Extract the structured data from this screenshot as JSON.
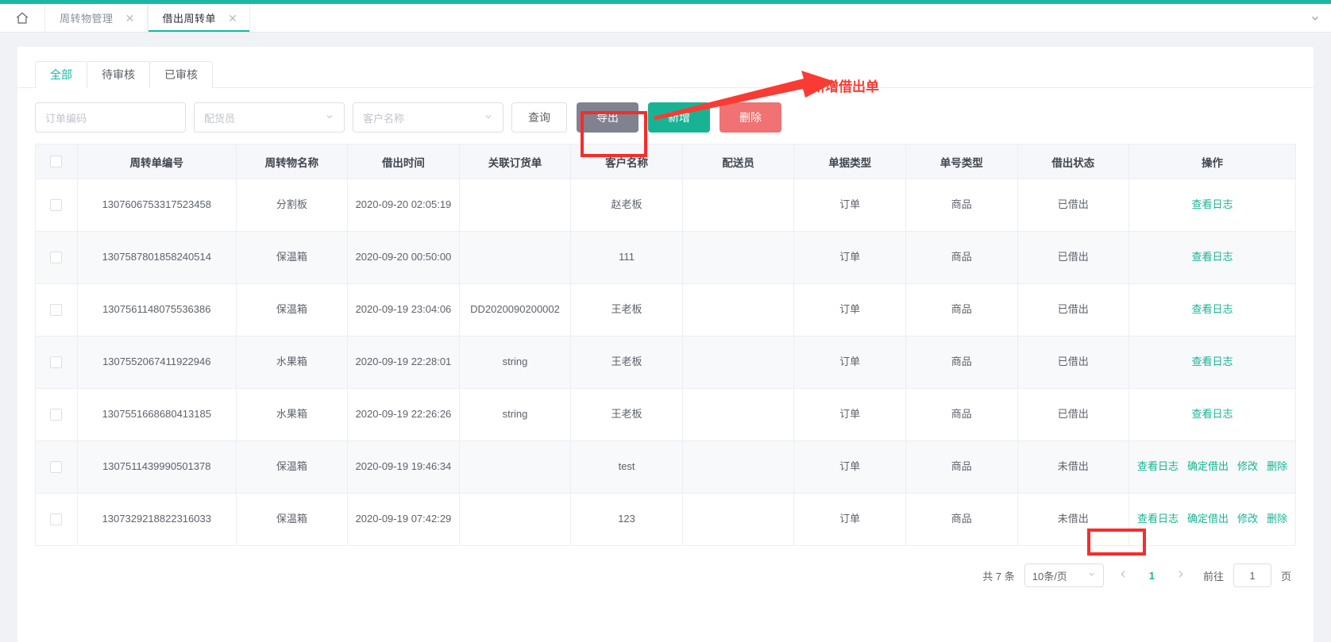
{
  "theme": {
    "accent": "#18b8a5",
    "link": "#18b394",
    "danger": "#f07272",
    "annotation": "#f93b34"
  },
  "tabbar": {
    "home_icon": "home-icon",
    "tabs": [
      {
        "label": "周转物管理",
        "active": false
      },
      {
        "label": "借出周转单",
        "active": true
      }
    ],
    "collapse_icon": "chevron-down-icon"
  },
  "filter_tabs": [
    {
      "label": "全部",
      "active": true
    },
    {
      "label": "待审核",
      "active": false
    },
    {
      "label": "已审核",
      "active": false
    }
  ],
  "search": {
    "order_code_placeholder": "订单编码",
    "order_code_value": "",
    "picker_placeholder": "配货员",
    "picker_value": "",
    "customer_placeholder": "客户名称",
    "customer_value": "",
    "query_label": "查询",
    "export_label": "导出",
    "add_label": "新增",
    "delete_label": "删除"
  },
  "annotation": {
    "text": "新增借出单"
  },
  "table": {
    "columns": [
      "",
      "周转单编号",
      "周转物名称",
      "借出时间",
      "关联订货单",
      "客户名称",
      "配送员",
      "单据类型",
      "单号类型",
      "借出状态",
      "操作"
    ],
    "rows": [
      {
        "code": "1307606753317523458",
        "goods": "分割板",
        "time": "2020-09-20 02:05:19",
        "related_order": "",
        "customer": "赵老板",
        "deliverer": "",
        "doc_type": "订单",
        "no_type": "商品",
        "status": "已借出",
        "ops": [
          "查看日志"
        ]
      },
      {
        "code": "1307587801858240514",
        "goods": "保温箱",
        "time": "2020-09-20 00:50:00",
        "related_order": "",
        "customer": "111",
        "deliverer": "",
        "doc_type": "订单",
        "no_type": "商品",
        "status": "已借出",
        "ops": [
          "查看日志"
        ]
      },
      {
        "code": "1307561148075536386",
        "goods": "保温箱",
        "time": "2020-09-19 23:04:06",
        "related_order": "DD2020090200002",
        "customer": "王老板",
        "deliverer": "",
        "doc_type": "订单",
        "no_type": "商品",
        "status": "已借出",
        "ops": [
          "查看日志"
        ]
      },
      {
        "code": "1307552067411922946",
        "goods": "水果箱",
        "time": "2020-09-19 22:28:01",
        "related_order": "string",
        "customer": "王老板",
        "deliverer": "",
        "doc_type": "订单",
        "no_type": "商品",
        "status": "已借出",
        "ops": [
          "查看日志"
        ]
      },
      {
        "code": "1307551668680413185",
        "goods": "水果箱",
        "time": "2020-09-19 22:26:26",
        "related_order": "string",
        "customer": "王老板",
        "deliverer": "",
        "doc_type": "订单",
        "no_type": "商品",
        "status": "已借出",
        "ops": [
          "查看日志"
        ]
      },
      {
        "code": "1307511439990501378",
        "goods": "保温箱",
        "time": "2020-09-19 19:46:34",
        "related_order": "",
        "customer": "test",
        "deliverer": "",
        "doc_type": "订单",
        "no_type": "商品",
        "status": "未借出",
        "ops": [
          "查看日志",
          "确定借出",
          "修改",
          "删除"
        ]
      },
      {
        "code": "1307329218822316033",
        "goods": "保温箱",
        "time": "2020-09-19 07:42:29",
        "related_order": "",
        "customer": "123",
        "deliverer": "",
        "doc_type": "订单",
        "no_type": "商品",
        "status": "未借出",
        "ops": [
          "查看日志",
          "确定借出",
          "修改",
          "删除"
        ]
      }
    ]
  },
  "pagination": {
    "total_label": "共 7 条",
    "page_size": "10条/页",
    "prev_icon": "chevron-left-icon",
    "current_page": "1",
    "next_icon": "chevron-right-icon",
    "jump_label": "前往",
    "jump_value": "1",
    "page_unit": "页"
  }
}
